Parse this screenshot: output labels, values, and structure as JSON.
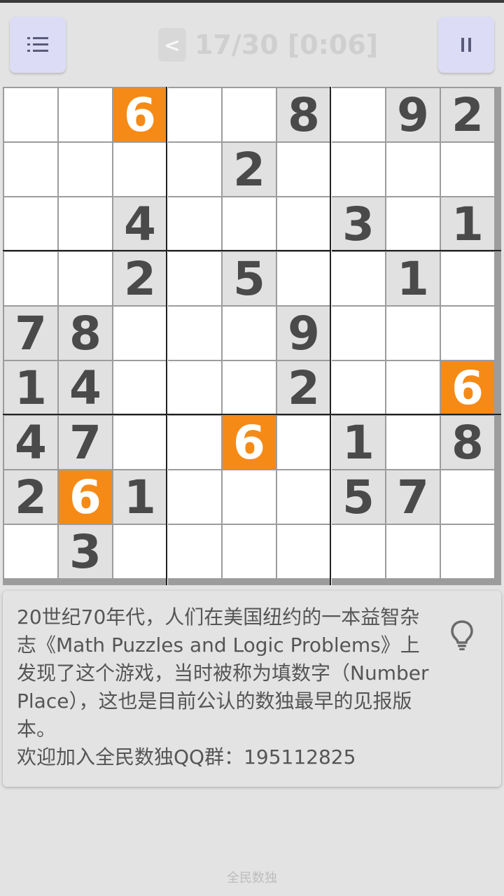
{
  "header": {
    "back_label": "<",
    "progress_text": "17/30 [0:06]",
    "menu_icon": "list-icon",
    "pause_icon": "pause-icon"
  },
  "colors": {
    "highlight": "#f68a17",
    "given_bg": "#e1e1e1",
    "empty_bg": "#ffffff",
    "digit": "#4a4a4a",
    "button_bg": "#dcdcf6"
  },
  "board": {
    "rows": [
      [
        "",
        "",
        "6",
        "",
        "",
        "8",
        "",
        "9",
        "2"
      ],
      [
        "",
        "",
        "",
        "",
        "2",
        "",
        "",
        "",
        ""
      ],
      [
        "",
        "",
        "4",
        "",
        "",
        "",
        "3",
        "",
        "1"
      ],
      [
        "",
        "",
        "2",
        "",
        "5",
        "",
        "",
        "1",
        ""
      ],
      [
        "7",
        "8",
        "",
        "",
        "",
        "9",
        "",
        "",
        ""
      ],
      [
        "1",
        "4",
        "",
        "",
        "",
        "2",
        "",
        "",
        "6"
      ],
      [
        "4",
        "7",
        "",
        "",
        "6",
        "",
        "1",
        "",
        "8"
      ],
      [
        "2",
        "6",
        "1",
        "",
        "",
        "",
        "5",
        "7",
        ""
      ],
      [
        "",
        "3",
        "",
        "",
        "",
        "",
        "",
        "",
        ""
      ]
    ],
    "highlighted_digit": "6"
  },
  "info": {
    "text": "20世纪70年代，人们在美国纽约的一本益智杂志《Math Puzzles and Logic Problems》上发现了这个游戏，当时被称为填数字（Number Place），这也是目前公认的数独最早的见报版本。\n欢迎加入全民数独QQ群：195112825",
    "hint_icon": "lightbulb-icon"
  },
  "footer": {
    "app_name": "全民数独"
  }
}
